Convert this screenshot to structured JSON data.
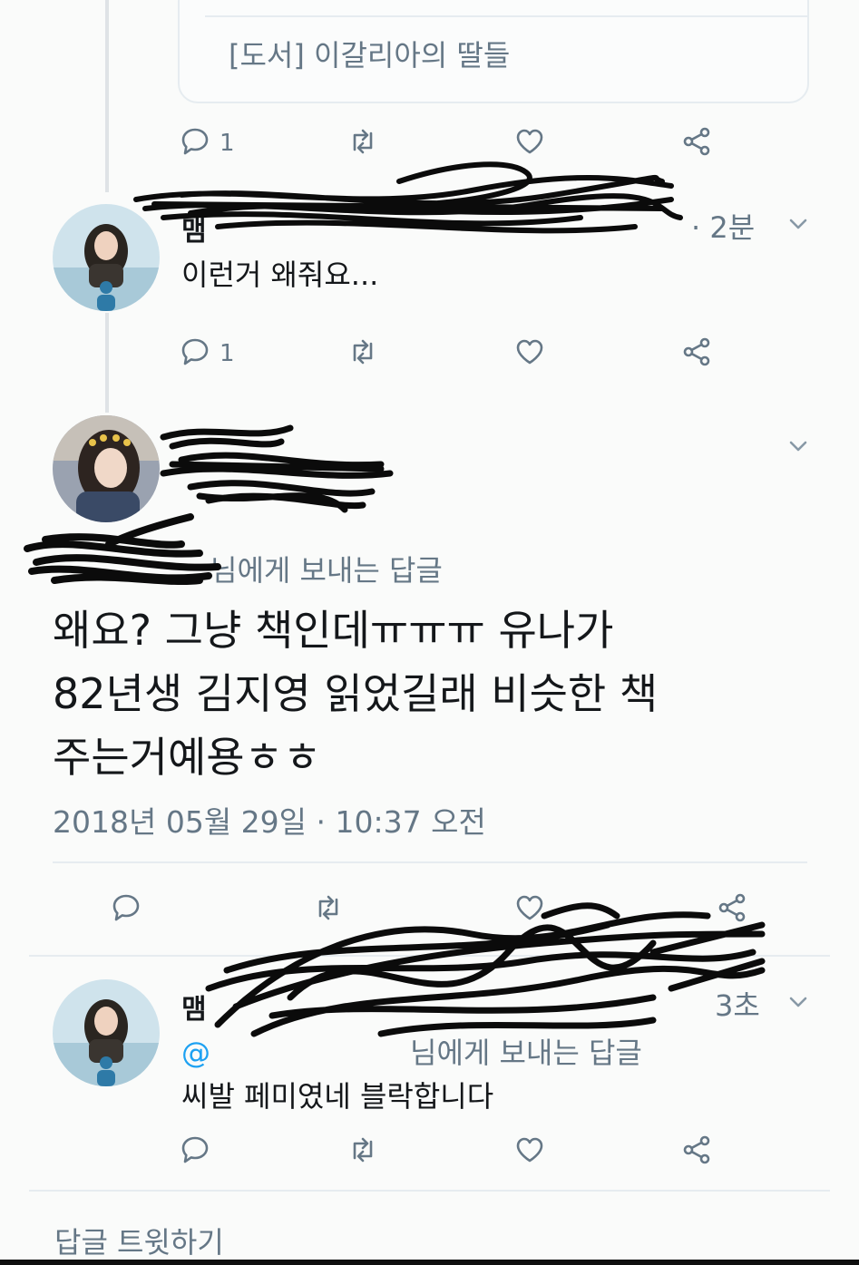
{
  "quoted_card": {
    "title": "[도서] 이갈리아의 딸들"
  },
  "tweet1_actions": {
    "reply_count": "1"
  },
  "reply1": {
    "name_fragment": "맴",
    "time": "· 2분",
    "text": "이런거 왜줘요...",
    "actions": {
      "reply_count": "1"
    }
  },
  "main_tweet": {
    "reply_to_suffix": "님에게 보내는 답글",
    "text_lines": [
      "왜요? 그냥 책인데ㅠㅠㅠ 유나가",
      "82년생 김지영 읽었길래 비슷한 책",
      "주는거예용ㅎㅎ"
    ],
    "timestamp": "2018년 05월 29일 · 10:37 오전"
  },
  "reply2": {
    "name_fragment": "맴",
    "time": "3초",
    "reply_to_prefix": "@",
    "reply_to_suffix": "님에게 보내는 답글",
    "text": "씨발 페미였네 블락합니다"
  },
  "compose": {
    "placeholder": "답글 트윗하기"
  },
  "icons": [
    "reply-icon",
    "retweet-icon",
    "like-icon",
    "share-icon",
    "chevron-down-icon"
  ],
  "colors": {
    "text": "#14171a",
    "secondary": "#657786",
    "link": "#1da1f2",
    "divider": "#e6ecf0"
  }
}
